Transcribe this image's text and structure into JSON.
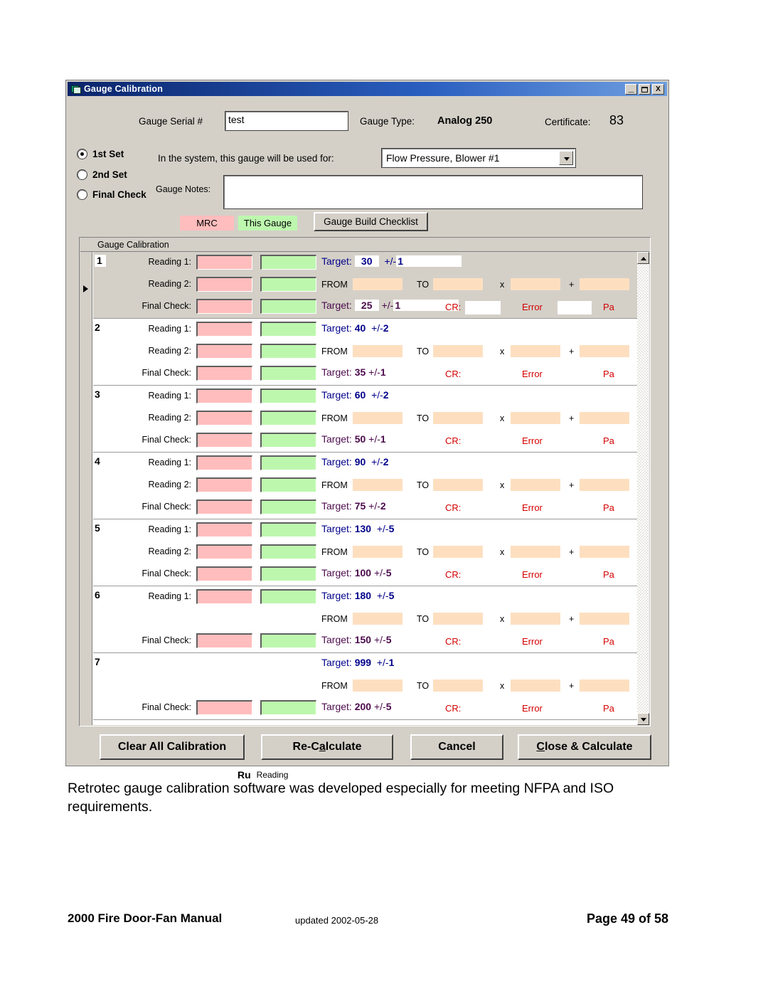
{
  "window": {
    "title": "Gauge Calibration",
    "icon": "app-window-icon",
    "controls": {
      "minimize": "_",
      "maximize": "□",
      "close": "X"
    }
  },
  "header": {
    "serial_label": "Gauge Serial #",
    "serial_value": "test",
    "gauge_type_label": "Gauge Type:",
    "gauge_type_value": "Analog 250",
    "certificate_label": "Certificate:",
    "certificate_value": "83",
    "used_for_label": "In the system, this gauge will be used for:",
    "used_for_value": "Flow Pressure, Blower #1",
    "notes_label": "Gauge Notes:",
    "notes_value": ""
  },
  "sets": [
    {
      "label": "1st Set",
      "selected": true
    },
    {
      "label": "2nd Set",
      "selected": false
    },
    {
      "label": "Final Check",
      "selected": false
    }
  ],
  "legend": {
    "mrc": "MRC",
    "mrc_color": "#ffbdbd",
    "this_gauge": "This Gauge",
    "this_gauge_color": "#bdf7ae",
    "checklist_button": "Gauge Build Checklist"
  },
  "grid": {
    "header": "Gauge Calibration",
    "labels": {
      "reading1": "Reading 1:",
      "reading2": "Reading 2:",
      "final_check": "Final Check:",
      "target": "Target:",
      "plusminus": "+/-",
      "from": "FROM",
      "to": "TO",
      "times": "x",
      "plus": "+",
      "cr": "CR:",
      "error": "Error",
      "pa": "Pa"
    },
    "colors": {
      "mrc_box": "#ffbdbd",
      "this_gauge_box": "#bdf7ae",
      "calc_box": "#fddfc0",
      "target_blue": "#00008b",
      "target_purple": "#4b0a4b",
      "error_red": "#d40000"
    },
    "rows": [
      {
        "num": "1",
        "current": true,
        "has_reading1": true,
        "has_reading2": true,
        "has_final": true,
        "target_top": "30",
        "tol_top": "1",
        "target_bottom": "25",
        "tol_bottom": "1",
        "from": "",
        "to": "",
        "mult": "",
        "add": "",
        "cr": "",
        "error": "",
        "editable": true
      },
      {
        "num": "2",
        "current": false,
        "has_reading1": true,
        "has_reading2": true,
        "has_final": true,
        "target_top": "40",
        "tol_top": "2",
        "target_bottom": "35",
        "tol_bottom": "1",
        "from": "",
        "to": "",
        "mult": "",
        "add": "",
        "cr": "",
        "error": "",
        "editable": false
      },
      {
        "num": "3",
        "current": false,
        "has_reading1": true,
        "has_reading2": true,
        "has_final": true,
        "target_top": "60",
        "tol_top": "2",
        "target_bottom": "50",
        "tol_bottom": "1",
        "from": "",
        "to": "",
        "mult": "",
        "add": "",
        "cr": "",
        "error": "",
        "editable": false
      },
      {
        "num": "4",
        "current": false,
        "has_reading1": true,
        "has_reading2": true,
        "has_final": true,
        "target_top": "90",
        "tol_top": "2",
        "target_bottom": "75",
        "tol_bottom": "2",
        "from": "",
        "to": "",
        "mult": "",
        "add": "",
        "cr": "",
        "error": "",
        "editable": false
      },
      {
        "num": "5",
        "current": false,
        "has_reading1": true,
        "has_reading2": true,
        "has_final": true,
        "target_top": "130",
        "tol_top": "5",
        "target_bottom": "100",
        "tol_bottom": "5",
        "from": "",
        "to": "",
        "mult": "",
        "add": "",
        "cr": "",
        "error": "",
        "editable": false
      },
      {
        "num": "6",
        "current": false,
        "has_reading1": true,
        "has_reading2": false,
        "has_final": true,
        "target_top": "180",
        "tol_top": "5",
        "target_bottom": "150",
        "tol_bottom": "5",
        "from": "",
        "to": "",
        "mult": "",
        "add": "",
        "cr": "",
        "error": "",
        "editable": false
      },
      {
        "num": "7",
        "current": false,
        "has_reading1": false,
        "has_reading2": false,
        "has_final": true,
        "target_top": "999",
        "tol_top": "1",
        "target_bottom": "200",
        "tol_bottom": "5",
        "from": "",
        "to": "",
        "mult": "",
        "add": "",
        "cr": "",
        "error": "",
        "editable": false
      }
    ]
  },
  "buttons": {
    "clear": "Clear All Calibration",
    "recalculate_pre": "Re-C",
    "recalculate_mn": "a",
    "recalculate_post": "lculate",
    "cancel": "Cancel",
    "close_mn": "C",
    "close_post": "lose & Calculate"
  },
  "status_strip": {
    "run": "Ru",
    "reading": "Reading"
  },
  "page": {
    "caption": "Retrotec gauge calibration software was developed especially for meeting NFPA and ISO requirements.",
    "footer_left": "2000 Fire Door-Fan Manual",
    "footer_middle": "updated 2002-05-28",
    "footer_right": "Page 49 of 58"
  }
}
